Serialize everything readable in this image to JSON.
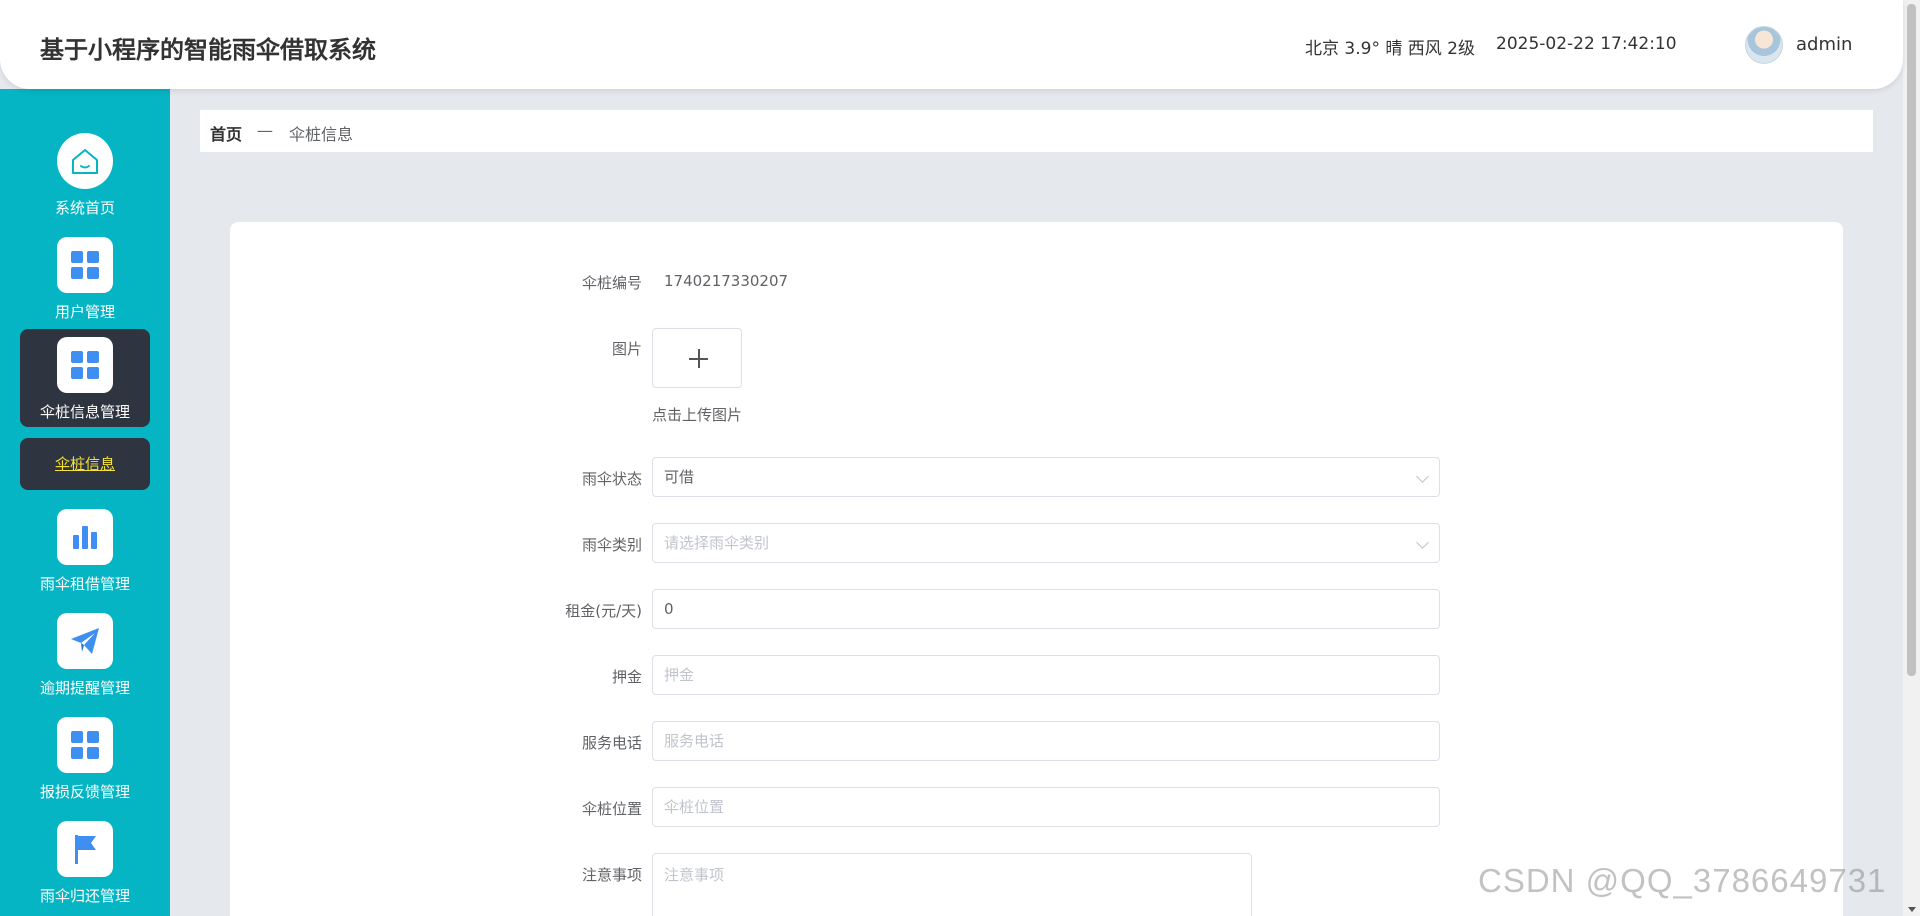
{
  "header": {
    "app_title": "基于小程序的智能雨伞借取系统",
    "weather": "北京  3.9°  晴  西风  2级",
    "datetime": "2025-02-22 17:42:10",
    "username": "admin"
  },
  "sidebar": {
    "items": [
      {
        "label": "系统首页",
        "icon": "home-icon"
      },
      {
        "label": "用户管理",
        "icon": "grid-icon"
      },
      {
        "label": "伞桩信息管理",
        "icon": "grid-icon",
        "active": true
      },
      {
        "label": "雨伞租借管理",
        "icon": "bar-chart-icon"
      },
      {
        "label": "逾期提醒管理",
        "icon": "paper-plane-icon"
      },
      {
        "label": "报损反馈管理",
        "icon": "grid-icon"
      },
      {
        "label": "雨伞归还管理",
        "icon": "flag-icon"
      }
    ],
    "submenu": {
      "label": "伞桩信息"
    }
  },
  "breadcrumb": {
    "home": "首页",
    "separator": "—",
    "current": "伞桩信息"
  },
  "form": {
    "station_no": {
      "label": "伞桩编号",
      "value": "1740217330207"
    },
    "image": {
      "label": "图片",
      "tip": "点击上传图片"
    },
    "umbrella_status": {
      "label": "雨伞状态",
      "value": "可借"
    },
    "umbrella_category": {
      "label": "雨伞类别",
      "placeholder": "请选择雨伞类别"
    },
    "rent": {
      "label": "租金(元/天)",
      "value": "0"
    },
    "deposit": {
      "label": "押金",
      "placeholder": "押金"
    },
    "service_phone": {
      "label": "服务电话",
      "placeholder": "服务电话"
    },
    "station_location": {
      "label": "伞桩位置",
      "placeholder": "伞桩位置"
    },
    "notes": {
      "label": "注意事项",
      "placeholder": "注意事项"
    }
  },
  "watermark": "CSDN @QQ_3786649731",
  "colors": {
    "sidebar_bg": "#05b5c3",
    "active_bg": "#2f3540",
    "icon_blue": "#3f8ef2",
    "submenu_text": "#f6e23a",
    "page_bg": "#e5e9ee"
  }
}
